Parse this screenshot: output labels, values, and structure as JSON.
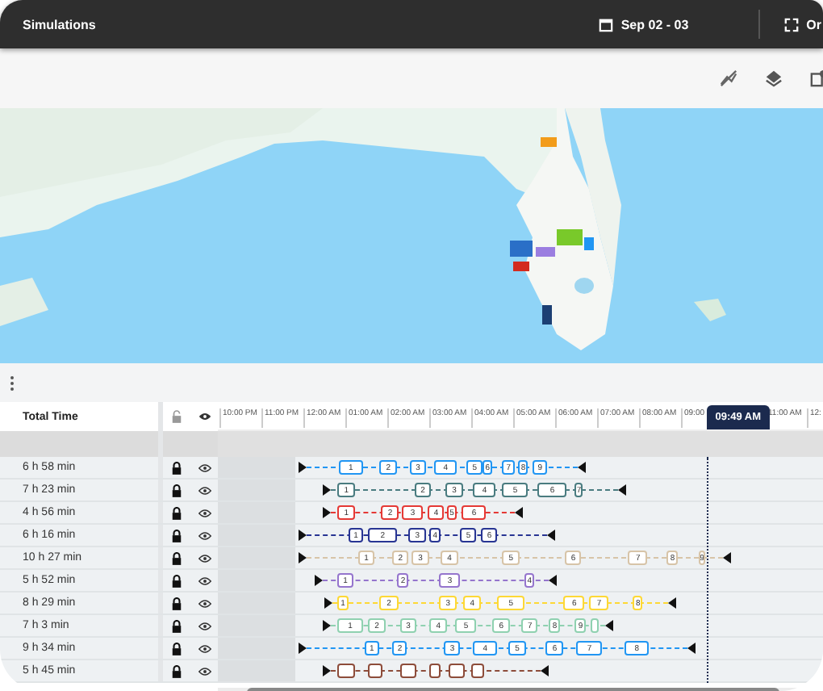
{
  "header": {
    "title": "Simulations",
    "date_range": "Sep 02 - 03",
    "view_label": "Or"
  },
  "table": {
    "total_time_heading": "Total Time"
  },
  "timeline": {
    "ticks": [
      "10:00 PM",
      "11:00 PM",
      "12:00 AM",
      "01:00 AM",
      "02:00 AM",
      "03:00 AM",
      "04:00 AM",
      "05:00 AM",
      "06:00 AM",
      "07:00 AM",
      "08:00 AM",
      "09:00",
      "11:00 AM",
      "12:"
    ],
    "now_marker": "09:49 AM"
  },
  "routes": [
    {
      "total_time": "6 h 58 min",
      "locked": true,
      "visible": true,
      "color": "#2196f3",
      "stops": [
        "1",
        "2",
        "3",
        "4",
        "5",
        "6",
        "7",
        "8",
        "9"
      ]
    },
    {
      "total_time": "7 h 23 min",
      "locked": true,
      "visible": true,
      "color": "#4a7c80",
      "stops": [
        "1",
        "2",
        "3",
        "4",
        "5",
        "6",
        "7"
      ]
    },
    {
      "total_time": "4 h 56 min",
      "locked": true,
      "visible": true,
      "color": "#e53935",
      "stops": [
        "1",
        "2",
        "3",
        "4",
        "5",
        "6"
      ]
    },
    {
      "total_time": "6 h 16 min",
      "locked": true,
      "visible": true,
      "color": "#283593",
      "stops": [
        "1",
        "2",
        "3",
        "4",
        "5",
        "6"
      ]
    },
    {
      "total_time": "10 h 27 min",
      "locked": true,
      "visible": true,
      "color": "#d7c4a8",
      "stops": [
        "1",
        "2",
        "3",
        "4",
        "5",
        "6",
        "7",
        "8",
        "9"
      ]
    },
    {
      "total_time": "5 h 52 min",
      "locked": true,
      "visible": true,
      "color": "#9575cd",
      "stops": [
        "1",
        "2",
        "3",
        "4"
      ]
    },
    {
      "total_time": "8 h 29 min",
      "locked": true,
      "visible": true,
      "color": "#fdd835",
      "stops": [
        "1",
        "2",
        "3",
        "4",
        "5",
        "6",
        "7",
        "8"
      ]
    },
    {
      "total_time": "7 h 3 min",
      "locked": true,
      "visible": true,
      "color": "#8fd1b0",
      "stops": [
        "1",
        "2",
        "3",
        "4",
        "5",
        "6",
        "7",
        "8",
        "9"
      ]
    },
    {
      "total_time": "9 h 34 min",
      "locked": true,
      "visible": true,
      "color": "#2196f3",
      "stops": [
        "1",
        "2",
        "3",
        "4",
        "5",
        "6",
        "7",
        "8"
      ]
    },
    {
      "total_time": "5 h 45 min",
      "locked": true,
      "visible": true,
      "color": "#8d4c3a"
    }
  ]
}
